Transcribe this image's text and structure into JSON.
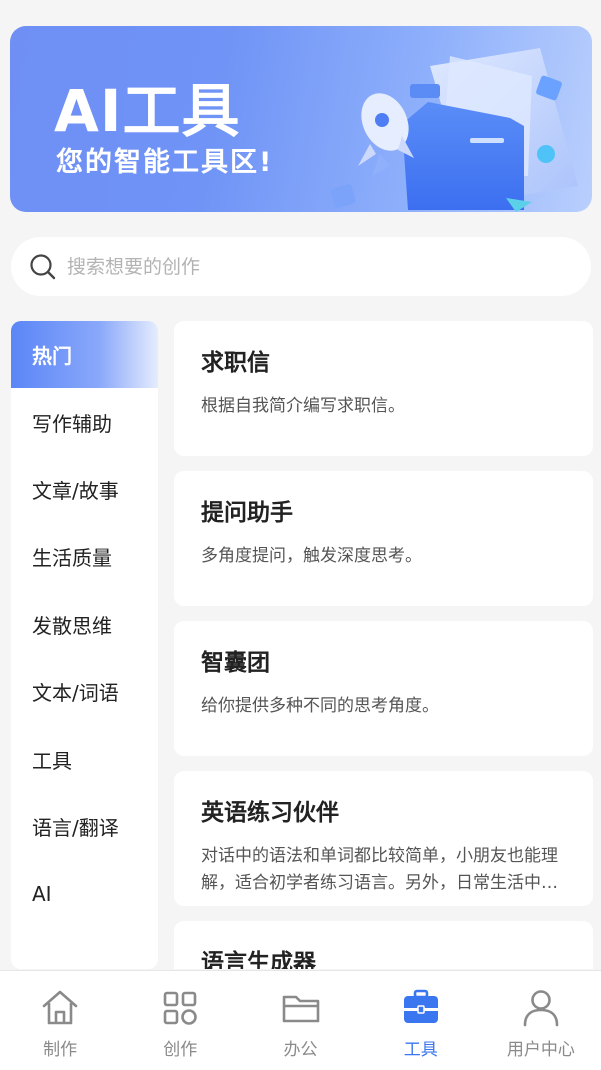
{
  "banner": {
    "title": "AI工具",
    "subtitle": "您的智能工具区!"
  },
  "search": {
    "placeholder": "搜索想要的创作",
    "value": ""
  },
  "sidebar": {
    "items": [
      {
        "label": "热门",
        "active": true
      },
      {
        "label": "写作辅助",
        "active": false
      },
      {
        "label": "文章/故事",
        "active": false
      },
      {
        "label": "生活质量",
        "active": false
      },
      {
        "label": "发散思维",
        "active": false
      },
      {
        "label": "文本/词语",
        "active": false
      },
      {
        "label": "工具",
        "active": false
      },
      {
        "label": "语言/翻译",
        "active": false
      },
      {
        "label": "AI",
        "active": false
      }
    ]
  },
  "cards": [
    {
      "title": "求职信",
      "desc": "根据自我简介编写求职信。"
    },
    {
      "title": "提问助手",
      "desc": "多角度提问，触发深度思考。"
    },
    {
      "title": "智囊团",
      "desc": "给你提供多种不同的思考角度。"
    },
    {
      "title": "英语练习伙伴",
      "desc": "对话中的语法和单词都比较简单，小朋友也能理解，适合初学者练习语言。另外，日常生活中的对话场景"
    },
    {
      "title": "语言生成器",
      "desc": ""
    }
  ],
  "tabbar": {
    "items": [
      {
        "label": "制作",
        "icon": "home-icon",
        "active": false
      },
      {
        "label": "创作",
        "icon": "grid-icon",
        "active": false
      },
      {
        "label": "办公",
        "icon": "folder-icon",
        "active": false
      },
      {
        "label": "工具",
        "icon": "briefcase-icon",
        "active": true
      },
      {
        "label": "用户中心",
        "icon": "user-icon",
        "active": false
      }
    ]
  },
  "colors": {
    "accent": "#3a76f0",
    "inactive": "#8a8a8a",
    "banner_start": "#6f8ff5",
    "banner_end": "#b9cffd"
  }
}
